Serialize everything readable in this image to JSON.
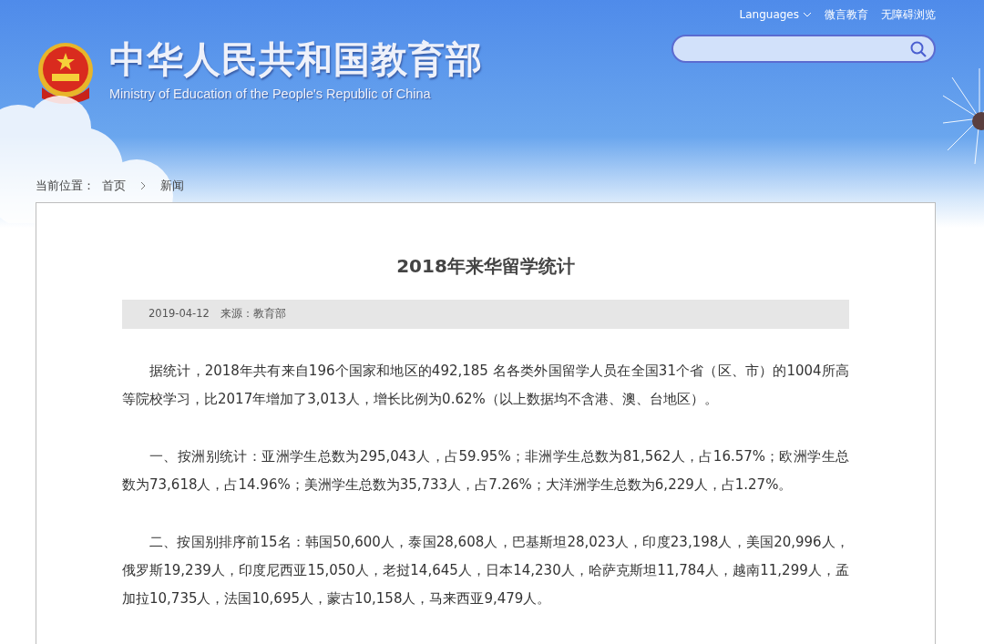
{
  "top_links": [
    {
      "label": "Languages",
      "kind": "dropdown"
    },
    {
      "label": "微言教育",
      "kind": "link"
    },
    {
      "label": "无障碍浏览",
      "kind": "link"
    }
  ],
  "header": {
    "title": "中华人民共和国教育部",
    "subtitle": "Ministry of Education of the People's Republic of China"
  },
  "breadcrumb": {
    "label": "当前位置：",
    "items": [
      "首页",
      "新闻"
    ]
  },
  "article": {
    "title": "2018年来华留学统计",
    "date": "2019-04-12",
    "source": "来源：教育部",
    "paragraphs": [
      "据统计，2018年共有来自196个国家和地区的492,185 名各类外国留学人员在全国31个省（区、市）的1004所高等院校学习，比2017年增加了3,013人，增长比例为0.62%（以上数据均不含港、澳、台地区）。",
      "一、按洲别统计：亚洲学生总数为295,043人，占59.95%；非洲学生总数为81,562人，占16.57%；欧洲学生总数为73,618人，占14.96%；美洲学生总数为35,733人，占7.26%；大洋洲学生总数为6,229人，占1.27%。",
      "二、按国别排序前15名：韩国50,600人，泰国28,608人，巴基斯坦28,023人，印度23,198人，美国20,996人，俄罗斯19,239人，印度尼西亚15,050人，老挝14,645人，日本14,230人，哈萨克斯坦11,784人，越南11,299人，孟加拉10,735人，法国10,695人，蒙古10,158人，马来西亚9,479人。"
    ]
  }
}
